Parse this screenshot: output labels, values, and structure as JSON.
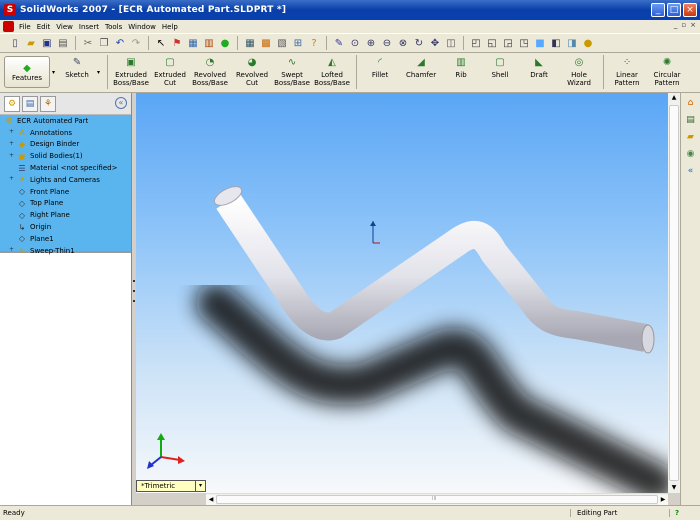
{
  "window": {
    "title": "SolidWorks 2007 - [ECR Automated Part.SLDPRT *]"
  },
  "menu": [
    "File",
    "Edit",
    "View",
    "Insert",
    "Tools",
    "Window",
    "Help"
  ],
  "command_manager": {
    "features_label": "Features",
    "sketch_label": "Sketch",
    "buttons": [
      {
        "label1": "Extruded",
        "label2": "Boss/Base",
        "icon": "extrude-icon"
      },
      {
        "label1": "Extruded",
        "label2": "Cut",
        "icon": "extruded-cut-icon"
      },
      {
        "label1": "Revolved",
        "label2": "Boss/Base",
        "icon": "revolve-icon"
      },
      {
        "label1": "Revolved",
        "label2": "Cut",
        "icon": "revolved-cut-icon"
      },
      {
        "label1": "Swept",
        "label2": "Boss/Base",
        "icon": "sweep-icon"
      },
      {
        "label1": "Lofted",
        "label2": "Boss/Base",
        "icon": "loft-icon"
      },
      {
        "label1": "Fillet",
        "label2": "",
        "icon": "fillet-icon"
      },
      {
        "label1": "Chamfer",
        "label2": "",
        "icon": "chamfer-icon"
      },
      {
        "label1": "Rib",
        "label2": "",
        "icon": "rib-icon"
      },
      {
        "label1": "Shell",
        "label2": "",
        "icon": "shell-icon"
      },
      {
        "label1": "Draft",
        "label2": "",
        "icon": "draft-icon"
      },
      {
        "label1": "Hole",
        "label2": "Wizard",
        "icon": "hole-wizard-icon"
      },
      {
        "label1": "Linear",
        "label2": "Pattern",
        "icon": "linear-pattern-icon"
      },
      {
        "label1": "Circular",
        "label2": "Pattern",
        "icon": "circular-pattern-icon"
      }
    ]
  },
  "tree": {
    "root": "ECR Automated Part",
    "items": [
      {
        "label": "Annotations",
        "expand": "+"
      },
      {
        "label": "Design Binder",
        "expand": "+"
      },
      {
        "label": "Solid Bodies(1)",
        "expand": "+"
      },
      {
        "label": "Material <not specified>",
        "expand": ""
      },
      {
        "label": "Lights and Cameras",
        "expand": "+"
      },
      {
        "label": "Front Plane",
        "expand": ""
      },
      {
        "label": "Top Plane",
        "expand": ""
      },
      {
        "label": "Right Plane",
        "expand": ""
      },
      {
        "label": "Origin",
        "expand": ""
      },
      {
        "label": "Plane1",
        "expand": ""
      },
      {
        "label": "Sweep-Thin1",
        "expand": "+"
      }
    ]
  },
  "view": {
    "orientation": "*Trimetric"
  },
  "status": {
    "left": "Ready",
    "mode": "Editing Part",
    "help": "?"
  },
  "colors": {
    "tree_bg": "#5ab5ee",
    "viewport_top": "#5aa6f5",
    "title_blue": "#0a3fa8"
  }
}
